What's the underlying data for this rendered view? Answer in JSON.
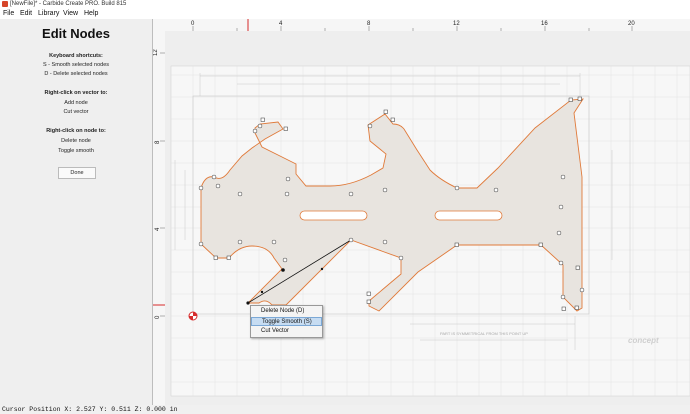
{
  "window": {
    "title": "[NewFile]* - Carbide Create PRO. Build 815"
  },
  "menu": [
    "File",
    "Edit",
    "Library",
    "View",
    "Help"
  ],
  "panel": {
    "title": "Edit Nodes",
    "shortcuts_heading": "Keyboard shortcuts:",
    "shortcut_smooth": "S - Smooth selected nodes",
    "shortcut_delete": "D - Delete selected nodes",
    "vector_heading": "Right-click on vector to:",
    "vector_add": "Add node",
    "vector_cut": "Cut vector",
    "node_heading": "Right-click on node to:",
    "node_delete": "Delete node",
    "node_toggle": "Toggle smooth",
    "done_label": "Done"
  },
  "ruler": {
    "x_ticks": [
      "0",
      "4",
      "8",
      "12",
      "16",
      "20"
    ],
    "y_ticks": [
      "12",
      "8",
      "4",
      "0"
    ]
  },
  "context_menu": {
    "items": [
      "Delete Node (D)",
      "Toggle Smooth (S)",
      "Cut Vector"
    ],
    "selected": "Toggle Smooth (S)"
  },
  "drawing_notes": {
    "symmetric_note": "PART IS SYMMETRICAL FROM THIS POINT UP",
    "logo": "concept"
  },
  "status": {
    "cursor_position": "Cursor Position X: 2.527 Y: 0.511 Z: 0.000 in"
  },
  "colors": {
    "shape_fill": "#e8e4df",
    "shape_stroke": "#e07a3a",
    "selection_highlight": "#c6dcf2"
  }
}
